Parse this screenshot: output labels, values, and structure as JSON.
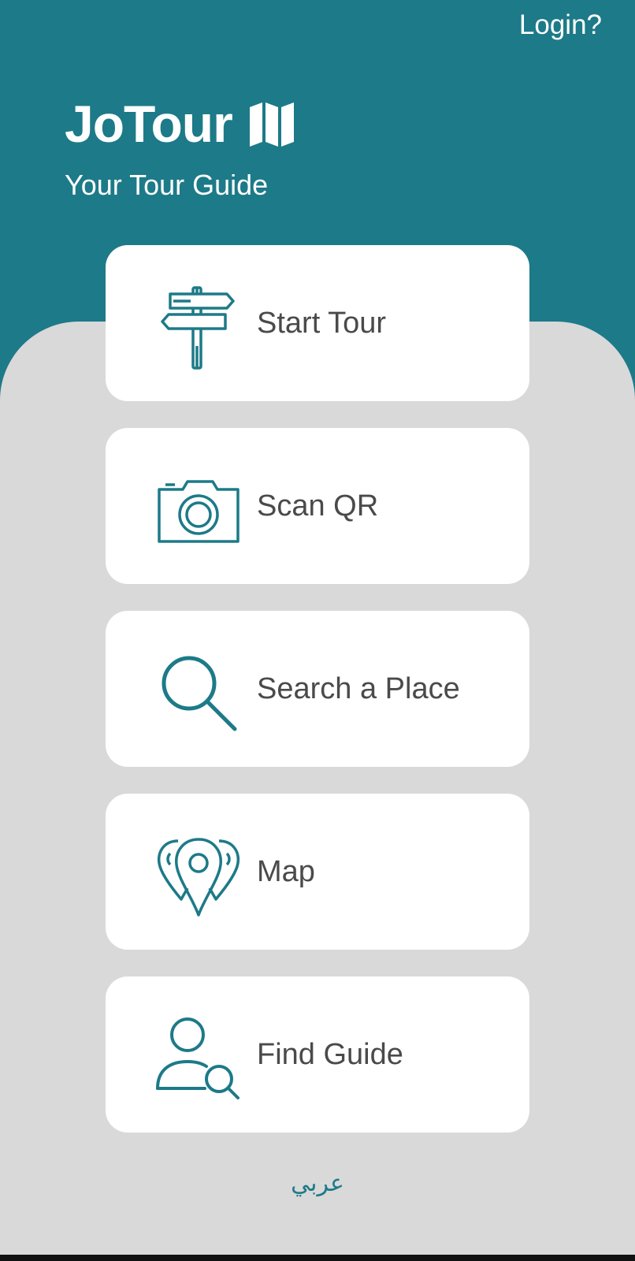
{
  "header": {
    "login_label": "Login?",
    "app_title": "JoTour",
    "app_icon": "map-icon",
    "subtitle": "Your Tour Guide"
  },
  "menu": {
    "items": [
      {
        "label": "Start Tour",
        "icon": "signpost-icon"
      },
      {
        "label": "Scan QR",
        "icon": "camera-icon"
      },
      {
        "label": "Search a Place",
        "icon": "magnifier-icon"
      },
      {
        "label": "Map",
        "icon": "map-pins-icon"
      },
      {
        "label": "Find Guide",
        "icon": "user-search-icon"
      }
    ]
  },
  "footer": {
    "language_label": "عربي"
  },
  "colors": {
    "primary": "#1d7a88",
    "background": "#d9d9d9",
    "card": "#ffffff",
    "label_text": "#4a4a4a"
  }
}
